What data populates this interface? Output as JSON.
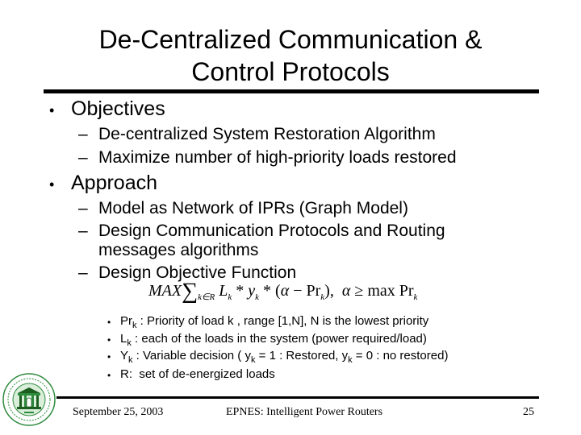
{
  "slide": {
    "title_line1": "De-Centralized Communication &",
    "title_line2": "Control Protocols"
  },
  "sections": [
    {
      "heading": "Objectives",
      "items": [
        "De-centralized System Restoration Algorithm",
        "Maximize number of high-priority loads restored"
      ]
    },
    {
      "heading": "Approach",
      "items": [
        "Model as Network of IPRs (Graph Model)",
        "Design Communication Protocols and Routing",
        "messages algorithms",
        "Design Objective Function"
      ]
    }
  ],
  "formula": {
    "max": "MAX",
    "sum_symbol": "∑",
    "sum_index": "k∈R",
    "term1": "L",
    "sub": "k",
    "times": " * ",
    "term2": "y",
    "open": "(",
    "alpha": "α",
    "minus": " − Pr",
    "close": "),",
    "constraint_alpha": "α",
    "constraint": " ≥ max Pr"
  },
  "definitions": [
    {
      "symbol": "Pr",
      "sub": "k",
      "text": " : Priority of load k , range [1,N], N is the lowest priority"
    },
    {
      "symbol": "L",
      "sub": "k",
      "text": " : each of the loads in the system (power required/load)"
    },
    {
      "symbol": "Y",
      "sub": "k",
      "text": " : Variable decision ( y",
      "sub2": "k",
      "text2": " = 1 : Restored, y",
      "sub3": "k",
      "text3": " = 0 : no restored)"
    },
    {
      "symbol": "R:",
      "text": "  set of de-energized loads"
    }
  ],
  "bullets": {
    "level1": "•",
    "level2": "–",
    "level3": "•"
  },
  "footer": {
    "date": "September 25, 2003",
    "title": "EPNES: Intelligent Power Routers",
    "page": "25"
  },
  "colors": {
    "text": "#000000",
    "rule": "#000000",
    "logo_green": "#2e8b3e",
    "logo_dark_green": "#1b5e20"
  }
}
